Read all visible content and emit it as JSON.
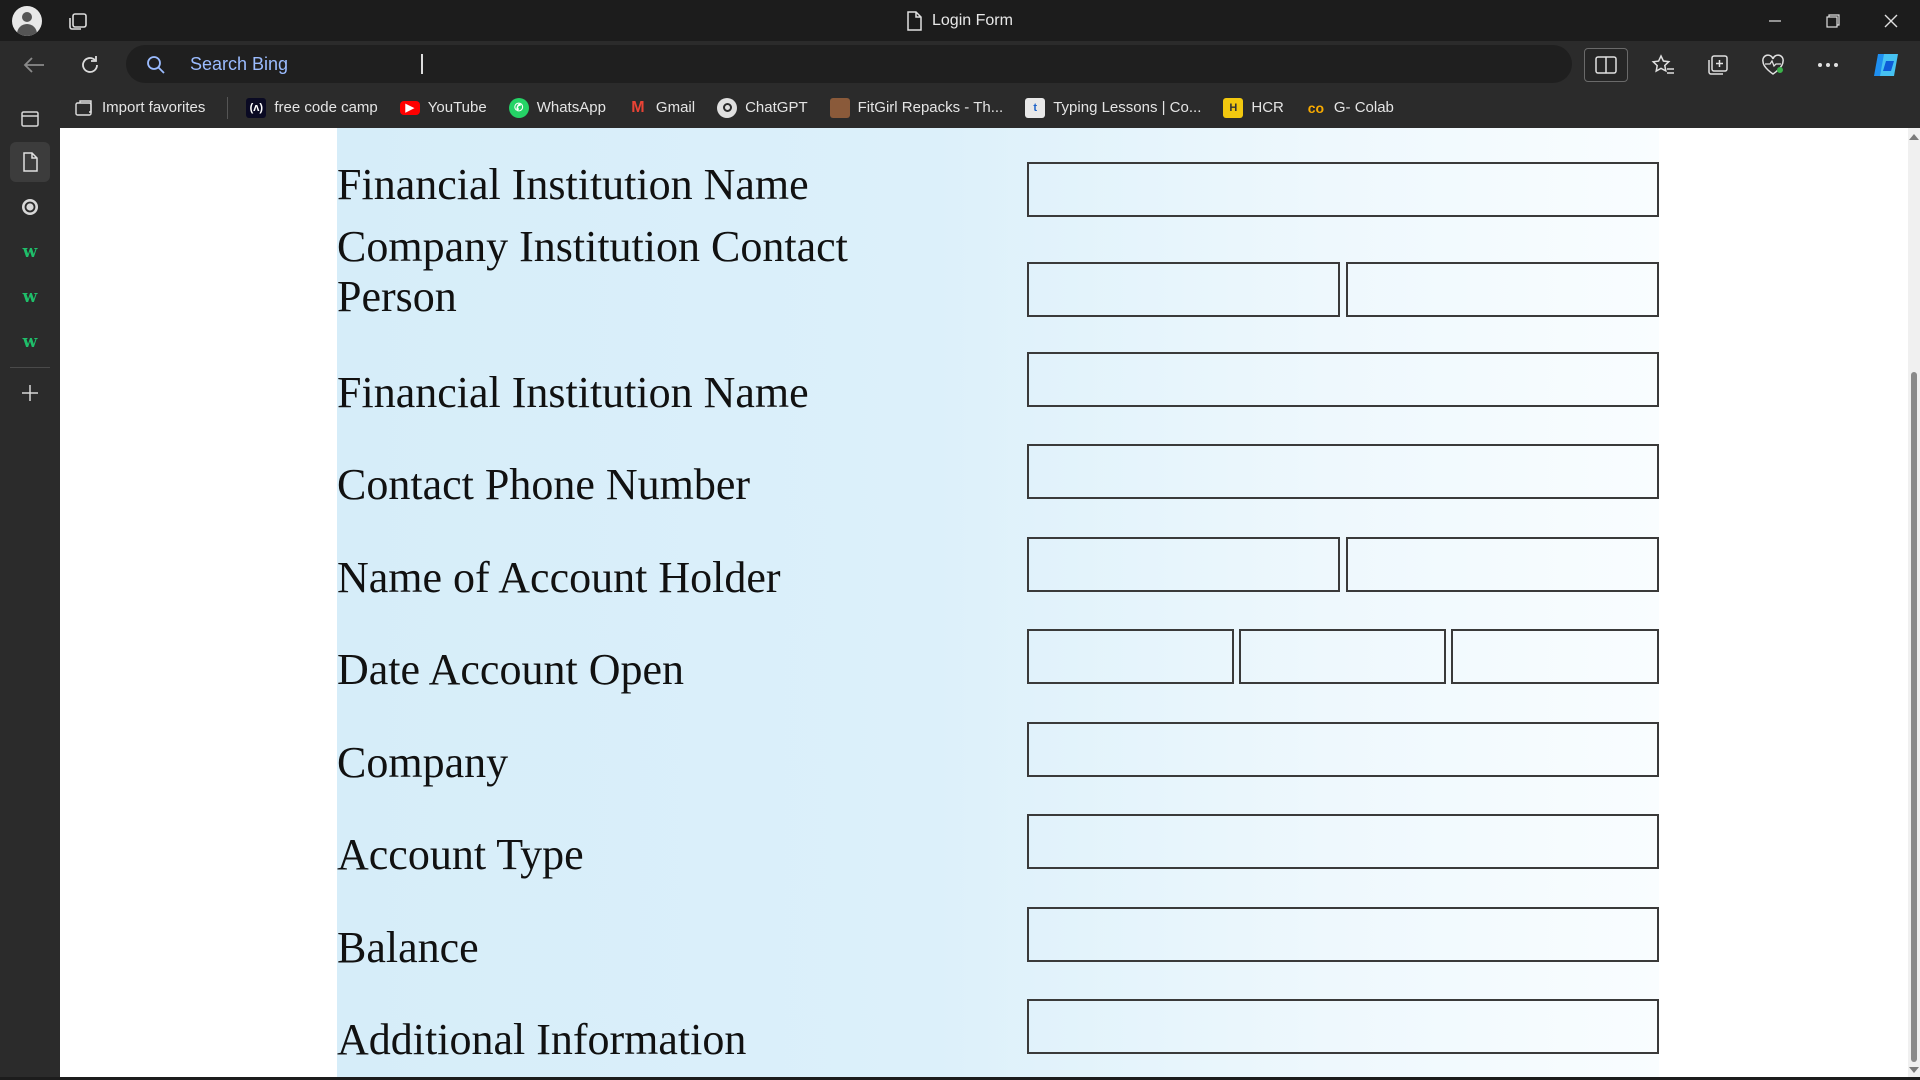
{
  "window": {
    "tab_title": "Login Form"
  },
  "address_bar": {
    "placeholder": "Search Bing",
    "value": ""
  },
  "favorites": [
    {
      "label": "Import favorites",
      "icon": "import-icon"
    },
    {
      "label": "free code camp",
      "icon": "freecodecamp-icon"
    },
    {
      "label": "YouTube",
      "icon": "youtube-icon"
    },
    {
      "label": "WhatsApp",
      "icon": "whatsapp-icon"
    },
    {
      "label": "Gmail",
      "icon": "gmail-icon"
    },
    {
      "label": "ChatGPT",
      "icon": "chatgpt-icon"
    },
    {
      "label": "FitGirl Repacks - Th...",
      "icon": "fitgirl-icon"
    },
    {
      "label": "Typing Lessons | Co...",
      "icon": "typing-icon"
    },
    {
      "label": "HCR",
      "icon": "hcr-icon"
    },
    {
      "label": "G- Colab",
      "icon": "colab-icon"
    }
  ],
  "form": {
    "rows": [
      {
        "label": "Financial Institution Name",
        "fields": 1
      },
      {
        "label": "Company Institution Contact Person",
        "fields": 2
      },
      {
        "label": "Financial Institution Name",
        "fields": 1
      },
      {
        "label": "Contact Phone Number",
        "fields": 1
      },
      {
        "label": "Name of Account Holder",
        "fields": 2
      },
      {
        "label": "Date Account Open",
        "fields": 3
      },
      {
        "label": "Company",
        "fields": 1
      },
      {
        "label": "Account Type",
        "fields": 1
      },
      {
        "label": "Balance",
        "fields": 1
      },
      {
        "label": "Additional Information",
        "fields": 1
      }
    ]
  },
  "colors": {
    "form_panel_start": "#d6edf9",
    "form_panel_end": "#f9fdff",
    "chrome_dark": "#1c1c1c",
    "link_accent": "#9bbcff"
  }
}
